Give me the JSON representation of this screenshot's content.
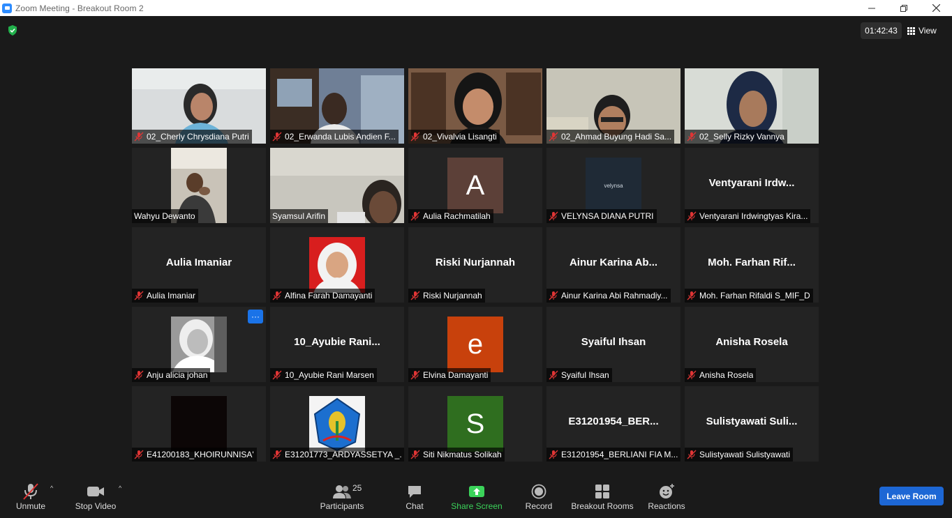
{
  "window": {
    "title": "Zoom Meeting - Breakout Room 2"
  },
  "topbar": {
    "timer": "01:42:43",
    "view_label": "View"
  },
  "tiles": [
    {
      "name": "02_Cherly Chrysdiana Putri"
    },
    {
      "name": "02_Erwanda Lubis Andien F..."
    },
    {
      "name": "02_Vivalvia Lisangti"
    },
    {
      "name": "02_Ahmad Buyung Hadi Sa..."
    },
    {
      "name": "02_Selly Rizky Vannya"
    },
    {
      "name": "Wahyu Dewanto"
    },
    {
      "name": "Syamsul Arifin"
    },
    {
      "name": "Aulia Rachmatilah",
      "initial": "A"
    },
    {
      "name": "VELYNSA DIANA PUTRI",
      "logo_text": "velynsa"
    },
    {
      "name": "Ventyarani Irdwingtyas Kira...",
      "big": "Ventyarani  Irdw..."
    },
    {
      "name": "Aulia Imaniar",
      "big": "Aulia Imaniar"
    },
    {
      "name": "Alfina Farah Damayanti"
    },
    {
      "name": "Riski Nurjannah",
      "big": "Riski Nurjannah"
    },
    {
      "name": "Ainur Karina Abi Rahmadiy...",
      "big": "Ainur  Karina  Ab..."
    },
    {
      "name": "Moh. Farhan Rifaldi S_MIF_D",
      "big": "Moh.  Farhan  Rif..."
    },
    {
      "name": "Anju alicia johan",
      "more": "···"
    },
    {
      "name": "10_Ayubie Rani Marsen",
      "big": "10_Ayubie  Rani..."
    },
    {
      "name": "Elvina Damayanti",
      "initial": "e"
    },
    {
      "name": "Syaiful Ihsan",
      "big": "Syaiful Ihsan"
    },
    {
      "name": "Anisha Rosela",
      "big": "Anisha Rosela"
    },
    {
      "name": "E41200183_KHOIRUNNISA'"
    },
    {
      "name": "E31201773_ARDYASSETYA _..."
    },
    {
      "name": "Siti Nikmatus Solikah",
      "initial": "S"
    },
    {
      "name": "E31201954_BERLIANI FIA M...",
      "big": "E31201954_BER..."
    },
    {
      "name": "Sulistyawati Sulistyawati",
      "big": "Sulistyawati  Suli..."
    }
  ],
  "toolbar": {
    "unmute": "Unmute",
    "stop_video": "Stop Video",
    "participants": "Participants",
    "participants_count": "25",
    "chat": "Chat",
    "share_screen": "Share Screen",
    "record": "Record",
    "breakout_rooms": "Breakout Rooms",
    "reactions": "Reactions",
    "leave_room": "Leave Room"
  },
  "colors": {
    "accent_green": "#3bd35a",
    "leave_blue": "#1d67d5",
    "active_speaker": "#e5e57a"
  }
}
